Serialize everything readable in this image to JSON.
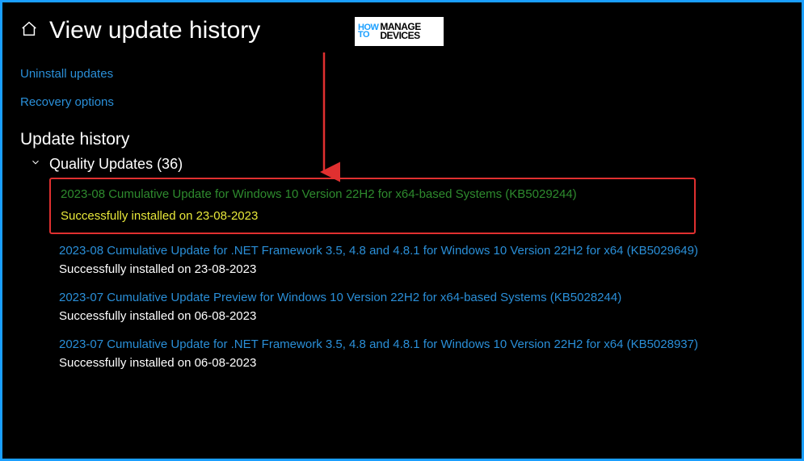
{
  "header": {
    "title": "View update history"
  },
  "logo": {
    "left_top": "HOW",
    "left_bottom": "TO",
    "right_top": "MANAGE",
    "right_bottom": "DEVICES"
  },
  "links": {
    "uninstall": "Uninstall updates",
    "recovery": "Recovery options"
  },
  "section": {
    "title": "Update history"
  },
  "group": {
    "label": "Quality Updates (36)"
  },
  "updates": [
    {
      "title": "2023-08 Cumulative Update for Windows 10 Version 22H2 for x64-based Systems (KB5029244)",
      "status": "Successfully installed on 23-08-2023"
    },
    {
      "title": "2023-08 Cumulative Update for .NET Framework 3.5, 4.8 and 4.8.1 for Windows 10 Version 22H2 for x64 (KB5029649)",
      "status": "Successfully installed on 23-08-2023"
    },
    {
      "title": "2023-07 Cumulative Update Preview for Windows 10 Version 22H2 for x64-based Systems (KB5028244)",
      "status": "Successfully installed on 06-08-2023"
    },
    {
      "title": "2023-07 Cumulative Update for .NET Framework 3.5, 4.8 and 4.8.1 for Windows 10 Version 22H2 for x64 (KB5028937)",
      "status": "Successfully installed on 06-08-2023"
    }
  ]
}
